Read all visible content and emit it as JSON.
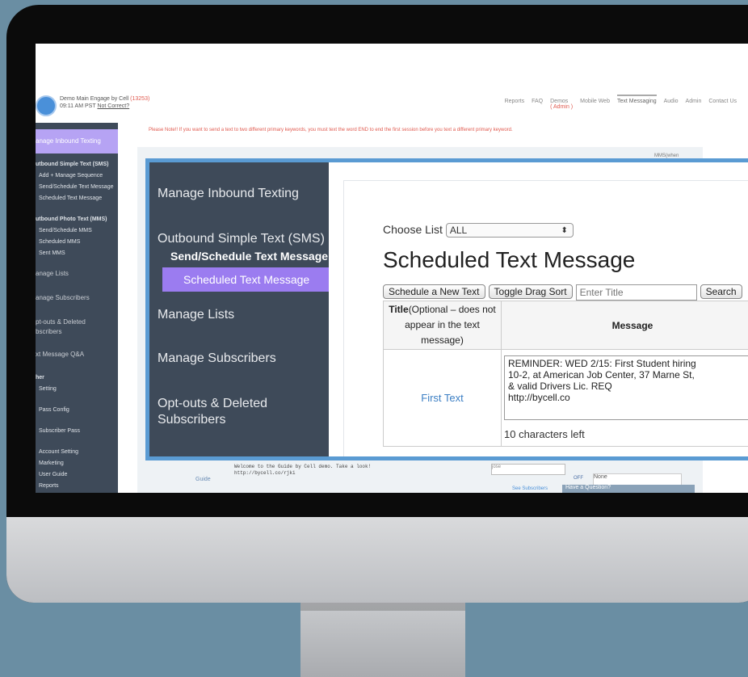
{
  "account": {
    "name": "Demo Main Engage by Cell",
    "id": "(13253)",
    "time": "09:11 AM PST",
    "not_correct": "Not Correct?"
  },
  "nav": {
    "items": [
      "Reports",
      "FAQ",
      "Demos",
      "Mobile Web",
      "Text Messaging",
      "Audio",
      "Admin",
      "Contact Us"
    ],
    "demos_sub": "( Admin )"
  },
  "note": "Please Note!! If you want to send a text to two different primary keywords, you must text the word END to end the first session before you text a different primary keyword.",
  "sidebar": {
    "items": [
      "anage Inbound Texting",
      "utbound Simple Text (SMS)",
      "Add + Manage Sequence",
      "Send/Schedule Text Message",
      "Scheduled Text Message",
      "utbound Photo Text (MMS)",
      "Send/Schedule MMS",
      "Scheduled MMS",
      "Sent MMS",
      "anage Lists",
      "anage Subscribers",
      "pt-outs & Deleted",
      "bscribers",
      "xt Message Q&A",
      "her",
      "Setting",
      "Pass Config",
      "Subscriber Pass",
      "Account Setting",
      "Marketing",
      "User Guide",
      "Reports"
    ]
  },
  "background": {
    "mms_header": "MMS(when",
    "row_message": "Welcome to the Guide by Cell demo. Take a look!\nhttp://bycell.co/rjki",
    "row_title": "Guide",
    "row_select": "jose",
    "row_off": "OFF",
    "row_none": "None",
    "see_subscribers": "See Subscribers",
    "have_question": "Have a Question?"
  },
  "zoom_sidebar": {
    "manage_inbound": "Manage Inbound Texting",
    "outbound_sms": "Outbound Simple Text (SMS)",
    "send_schedule": "Send/Schedule Text Message",
    "scheduled": "Scheduled Text Message",
    "manage_lists": "Manage Lists",
    "manage_subscribers": "Manage Subscribers",
    "optouts_1": "Opt-outs & Deleted",
    "optouts_2": "Subscribers"
  },
  "main": {
    "choose_list_label": "Choose List",
    "choose_list_value": "ALL",
    "page_title": "Scheduled Text Message",
    "schedule_button": "Schedule a New Text",
    "toggle_button": "Toggle Drag Sort",
    "title_placeholder": "Enter Title",
    "search_button": "Search",
    "col_title_bold": "Title",
    "col_title_rest": "(Optional – does not appear in the text message)",
    "col_message": "Message",
    "rows": [
      {
        "title": "First Text",
        "message": "REMINDER: WED 2/15: First Student hiring\n10-2, at American Job Center, 37 Marne St,\n& valid Drivers Lic. REQ\nhttp://bycell.co",
        "chars_left": "10 characters left"
      }
    ]
  }
}
